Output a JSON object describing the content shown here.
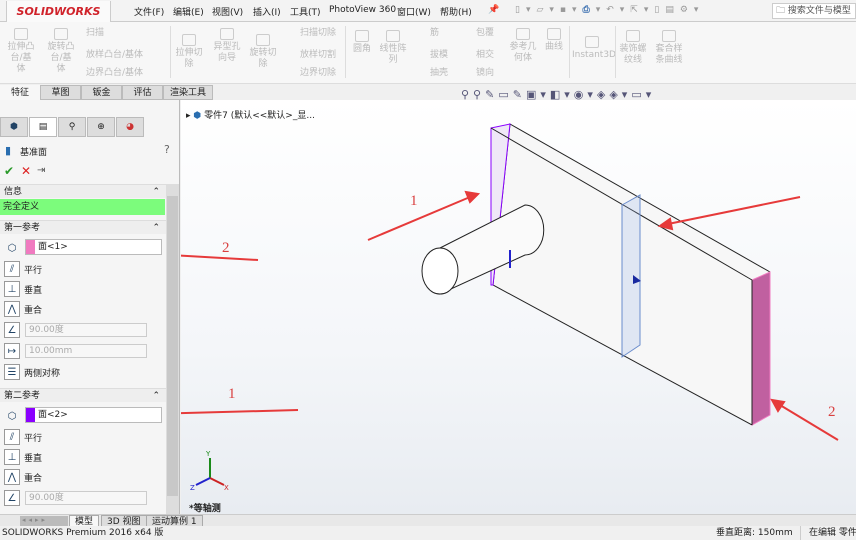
{
  "app": {
    "logo": "SOLIDWORKS",
    "brand_color": "#d0222a"
  },
  "menu": [
    "文件(F)",
    "编辑(E)",
    "视图(V)",
    "插入(I)",
    "工具(T)",
    "PhotoView 360",
    "窗口(W)",
    "帮助(H)"
  ],
  "search": {
    "placeholder": "搜索文件与模型"
  },
  "ribbon": {
    "big": [
      "拉伸凸台/基体",
      "旋转凸台/基体",
      "拉伸切除",
      "异型孔向导",
      "旋转切除",
      "圆角",
      "线性阵列",
      "参考几何体",
      "曲线",
      "Instant3D",
      "装饰螺纹线",
      "套合样条曲线"
    ],
    "small": [
      "扫描",
      "放样凸台/基体",
      "边界凸台/基体",
      "扫描切除",
      "放样切割",
      "边界切除",
      "筋",
      "拔模",
      "抽壳",
      "包覆",
      "相交",
      "镜向"
    ]
  },
  "command_tabs": [
    "特征",
    "草图",
    "钣金",
    "评估",
    "渲染工具"
  ],
  "tree": {
    "root": "零件7 (默认<<默认>_显..."
  },
  "panel": {
    "title": "基准面",
    "help": "?",
    "info": {
      "header": "信息",
      "status": "完全定义",
      "status_color": "#7cfc7c"
    },
    "first": {
      "header": "第一参考",
      "selection": "面<1>",
      "color": "#f07ac0",
      "options": [
        "平行",
        "垂直",
        "重合"
      ],
      "angle": "90.00度",
      "distance": "10.00mm",
      "symmetric": "两侧对称"
    },
    "second": {
      "header": "第二参考",
      "selection": "面<2>",
      "color": "#8a00ff",
      "options": [
        "平行",
        "垂直",
        "重合"
      ],
      "angle": "90.00度"
    }
  },
  "annotations": {
    "a1": "1",
    "a2": "2",
    "a3": "2",
    "a4": "1",
    "a5": "2"
  },
  "triad": {
    "x": "X",
    "y": "Y",
    "z": "Z"
  },
  "view_label": "*等轴测",
  "bottom_tabs": [
    "模型",
    "3D 视图",
    "运动算例 1"
  ],
  "status": {
    "product": "SOLIDWORKS Premium 2016 x64 版",
    "distance": "垂直距离: 150mm",
    "mode": "在编辑 零件"
  }
}
